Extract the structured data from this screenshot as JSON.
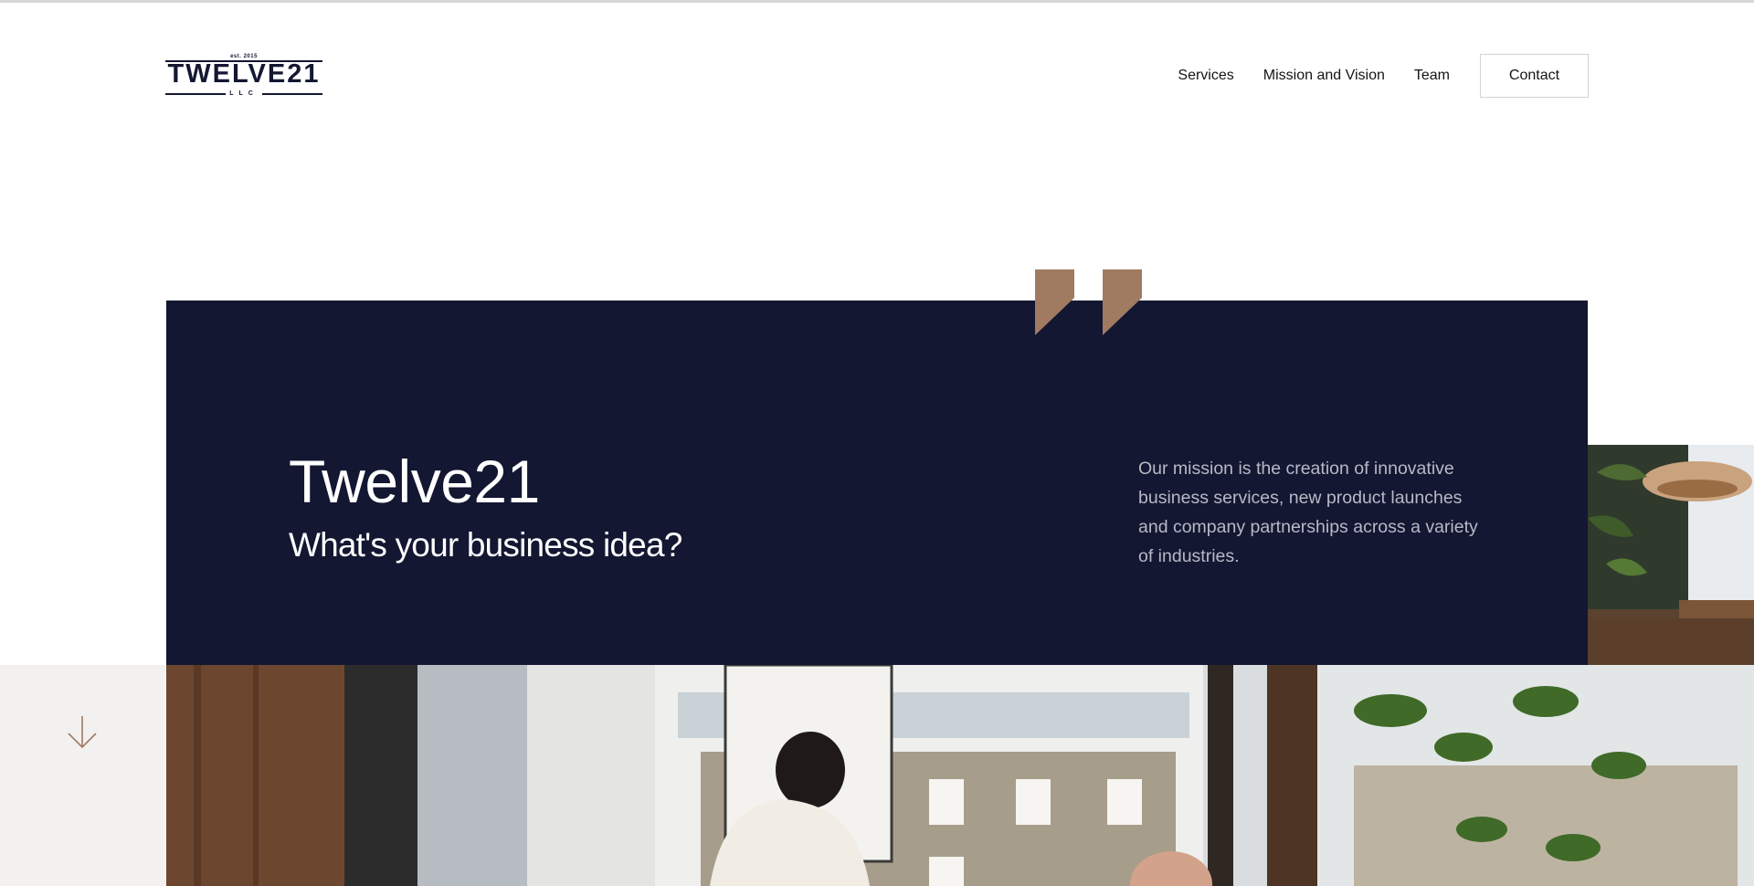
{
  "logo": {
    "established": "est. 2015",
    "name": "TWELVE21",
    "suffix": "LLC"
  },
  "nav": {
    "items": [
      {
        "label": "Services"
      },
      {
        "label": "Mission and Vision"
      },
      {
        "label": "Team"
      }
    ],
    "contact_label": "Contact"
  },
  "hero": {
    "title": "Twelve21",
    "subtitle": "What's your business idea?",
    "mission": "Our mission is the creation of innovative business services, new product launches and company partnerships across a variety of industries."
  },
  "colors": {
    "navy": "#131732",
    "accent": "#a07b61",
    "light_gray": "#f2f1f0",
    "muted_text": "#b7b9c6"
  },
  "icons": {
    "scroll": "arrow-down-icon",
    "quote": "quote-icon"
  }
}
